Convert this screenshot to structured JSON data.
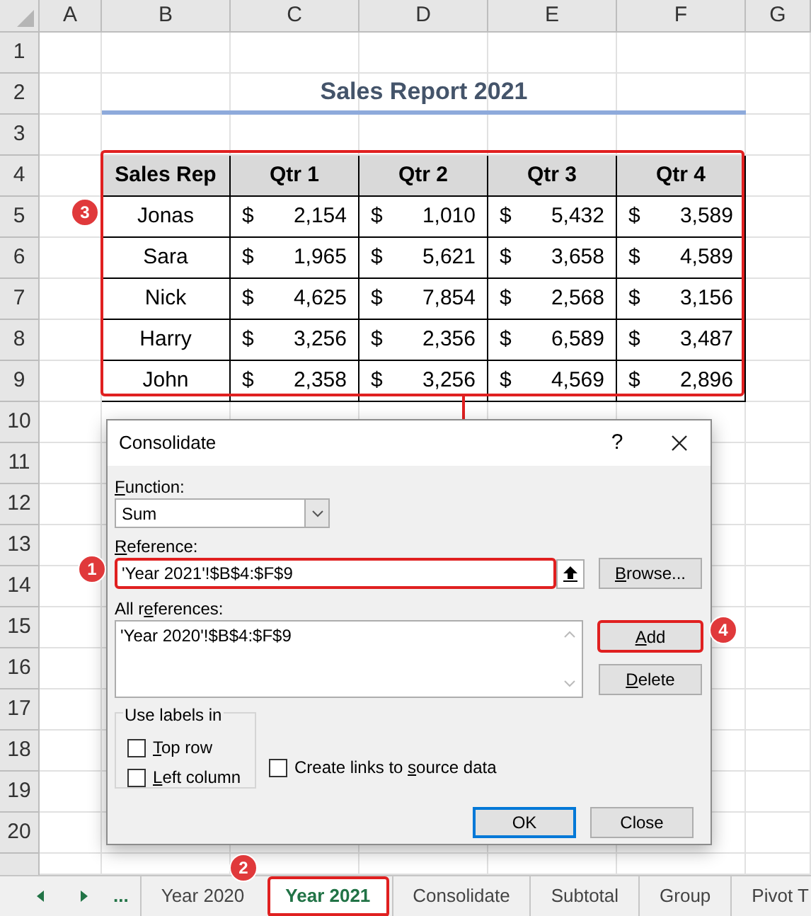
{
  "columns": [
    "A",
    "B",
    "C",
    "D",
    "E",
    "F",
    "G"
  ],
  "rows": [
    "1",
    "2",
    "3",
    "4",
    "5",
    "6",
    "7",
    "8",
    "9",
    "10",
    "11",
    "12",
    "13",
    "14",
    "15",
    "16",
    "17",
    "18",
    "19",
    "20"
  ],
  "report_title": "Sales Report 2021",
  "table": {
    "columns": [
      "Sales Rep",
      "Qtr 1",
      "Qtr 2",
      "Qtr 3",
      "Qtr 4"
    ],
    "rows": [
      {
        "cells": [
          {
            "kind": "text",
            "value": "Jonas"
          },
          {
            "kind": "money",
            "symbol": "$",
            "value": "2,154"
          },
          {
            "kind": "money",
            "symbol": "$",
            "value": "1,010"
          },
          {
            "kind": "money",
            "symbol": "$",
            "value": "5,432"
          },
          {
            "kind": "money",
            "symbol": "$",
            "value": "3,589"
          }
        ]
      },
      {
        "cells": [
          {
            "kind": "text",
            "value": "Sara"
          },
          {
            "kind": "money",
            "symbol": "$",
            "value": "1,965"
          },
          {
            "kind": "money",
            "symbol": "$",
            "value": "5,621"
          },
          {
            "kind": "money",
            "symbol": "$",
            "value": "3,658"
          },
          {
            "kind": "money",
            "symbol": "$",
            "value": "4,589"
          }
        ]
      },
      {
        "cells": [
          {
            "kind": "text",
            "value": "Nick"
          },
          {
            "kind": "money",
            "symbol": "$",
            "value": "4,625"
          },
          {
            "kind": "money",
            "symbol": "$",
            "value": "7,854"
          },
          {
            "kind": "money",
            "symbol": "$",
            "value": "2,568"
          },
          {
            "kind": "money",
            "symbol": "$",
            "value": "3,156"
          }
        ]
      },
      {
        "cells": [
          {
            "kind": "text",
            "value": "Harry"
          },
          {
            "kind": "money",
            "symbol": "$",
            "value": "3,256"
          },
          {
            "kind": "money",
            "symbol": "$",
            "value": "2,356"
          },
          {
            "kind": "money",
            "symbol": "$",
            "value": "6,589"
          },
          {
            "kind": "money",
            "symbol": "$",
            "value": "3,487"
          }
        ]
      },
      {
        "cells": [
          {
            "kind": "text",
            "value": "John"
          },
          {
            "kind": "money",
            "symbol": "$",
            "value": "2,358"
          },
          {
            "kind": "money",
            "symbol": "$",
            "value": "3,256"
          },
          {
            "kind": "money",
            "symbol": "$",
            "value": "4,569"
          },
          {
            "kind": "money",
            "symbol": "$",
            "value": "2,896"
          }
        ]
      }
    ]
  },
  "dialog": {
    "title": "Consolidate",
    "help": "?",
    "function": {
      "label": {
        "key": "F",
        "after": "unction:"
      },
      "value": "Sum"
    },
    "reference": {
      "label": {
        "key": "R",
        "after": "eference:"
      },
      "value": "'Year 2021'!$B$4:$F$9"
    },
    "browse_button": {
      "key": "B",
      "after": "rowse..."
    },
    "all_references": {
      "label": {
        "before": "All r",
        "key": "e",
        "after": "ferences:"
      },
      "items": [
        "'Year 2020'!$B$4:$F$9"
      ]
    },
    "add_button": {
      "key": "A",
      "after": "dd"
    },
    "delete_button": {
      "key": "D",
      "after": "elete"
    },
    "use_labels": {
      "title": "Use labels in",
      "options": [
        {
          "label": {
            "key": "T",
            "after": "op row"
          },
          "checked": false
        },
        {
          "label": {
            "key": "L",
            "after": "eft column"
          },
          "checked": false
        }
      ]
    },
    "create_links": {
      "label": {
        "before": "Create links to ",
        "key": "s",
        "after": "ource data"
      },
      "checked": false
    },
    "ok_button": "OK",
    "close_button": "Close"
  },
  "sheet_tabs": {
    "more": "...",
    "tabs": [
      {
        "label": "Year 2020",
        "selected": false
      },
      {
        "label": "Year 2021",
        "selected": true
      },
      {
        "label": "Consolidate",
        "selected": false
      },
      {
        "label": "Subtotal",
        "selected": false
      },
      {
        "label": "Group",
        "selected": false
      },
      {
        "label": "Pivot T",
        "selected": false
      }
    ]
  },
  "callouts": [
    "3",
    "1",
    "4",
    "2"
  ]
}
